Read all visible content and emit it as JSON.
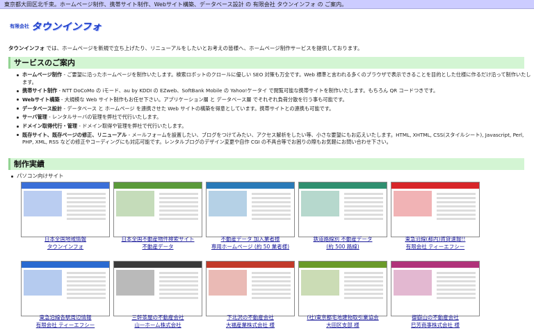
{
  "topbar": "東京都大田区北千束。ホームページ制作、携帯サイト制作、Webサイト構築、データベース設計 の 有限会社 タウンインフォ の ご案内。",
  "logo": {
    "small": "有限会社",
    "big": "タウンインフォ"
  },
  "intro": {
    "brand": "タウンインフォ",
    "text": " では、ホームページを新規で立ち上げたり、リニューアルをしたいとお考えの皆様へ、ホームページ制作サービスを提供しております。"
  },
  "services": {
    "heading": "サービスのご案内",
    "items": [
      {
        "title": "ホームページ制作",
        "desc": " - ご要望に沿ったホームページを制作いたします。検索ロボットのクロールに優しい SEO 対策も万全です。Web 標準と言われる多くのブラウザで表示できることを目的とした仕様に作るだけ沿って制作いたします。"
      },
      {
        "title": "携帯サイト制作",
        "desc": " - NTT DoCoMo の iモード、au by KDDI の EZweb、SoftBank Mobile の Yahoo!ケータイ で閲覧可能な携帯サイトを制作いたします。もちろん QR コードつきです。"
      },
      {
        "title": "Webサイト構築",
        "desc": " - 大規模な Web サイト制作もお任せ下さい。アプリケーション層 と データベース層 でそれぞれ負荷分散を行う事も可能です。"
      },
      {
        "title": "データベース設計",
        "desc": " - データベース と ホームページ を連携させた Web サイトの構築を得意としています。携帯サイトとの連携も可能です。"
      },
      {
        "title": "サーバ管理",
        "desc": " - レンタルサーバの管理を弊社で代行いたします。"
      },
      {
        "title": "ドメイン取得代行・管理",
        "desc": " - ドメイン取得や管理を弊社で代行いたします。"
      },
      {
        "title": "既存サイト、既存ページの修正、リニューアル",
        "desc": " - メールフォームを設置したい、ブログをつけてみたい、アクセス解析をしたい等、小さな要望にもお応えいたします。HTML, XHTML, CSS(スタイルシート), Javascript, Perl, PHP, XML, RSS などの修正やコーディングにも対応可能です。レンタルブログのデザイン変更や自作 CGI の不具合等でお困りの際もお気軽にお問い合わせ下さい。"
      }
    ]
  },
  "works": {
    "heading": "制作実績",
    "subheading": "パソコン向けサイト",
    "items": [
      {
        "line1": "日本全国地域情報",
        "line2": "タウンインフォ",
        "accent": "#3a6fd8"
      },
      {
        "line1": "日本全国不動産物件検索サイト",
        "line2": "不動産データ",
        "accent": "#5a9a3a"
      },
      {
        "line1": "不動産データ 加入業者様",
        "line2": "専用ホームページ (約 50 業者様)",
        "accent": "#2a7ab8"
      },
      {
        "line1": "鉄道路線別 不動産データ",
        "line2": "(約 500 路線)",
        "accent": "#2f8f6f"
      },
      {
        "line1": "東急沿線(都内)賃貸速報!!",
        "line2": "有限会社 ティーエフシー",
        "accent": "#d8262a"
      },
      {
        "line1": "東急沿線各駅周辺情報",
        "line2": "有限会社 ティーエフシー",
        "accent": "#2a6ad0"
      },
      {
        "line1": "三軒茶屋の不動産会社",
        "line2": "山一ホーム株式会社",
        "accent": "#3a3a3a"
      },
      {
        "line1": "下北沢の不動産会社",
        "line2": "大福産業株式会社 様",
        "accent": "#c23a2a"
      },
      {
        "line1": "(社)東京都宅地建物取引業協会",
        "line2": "大田区支部 様",
        "accent": "#6a9a2a"
      },
      {
        "line1": "御嶽山の不動産会社",
        "line2": "巳芳商事株式会社 様",
        "accent": "#b0337a"
      }
    ]
  }
}
